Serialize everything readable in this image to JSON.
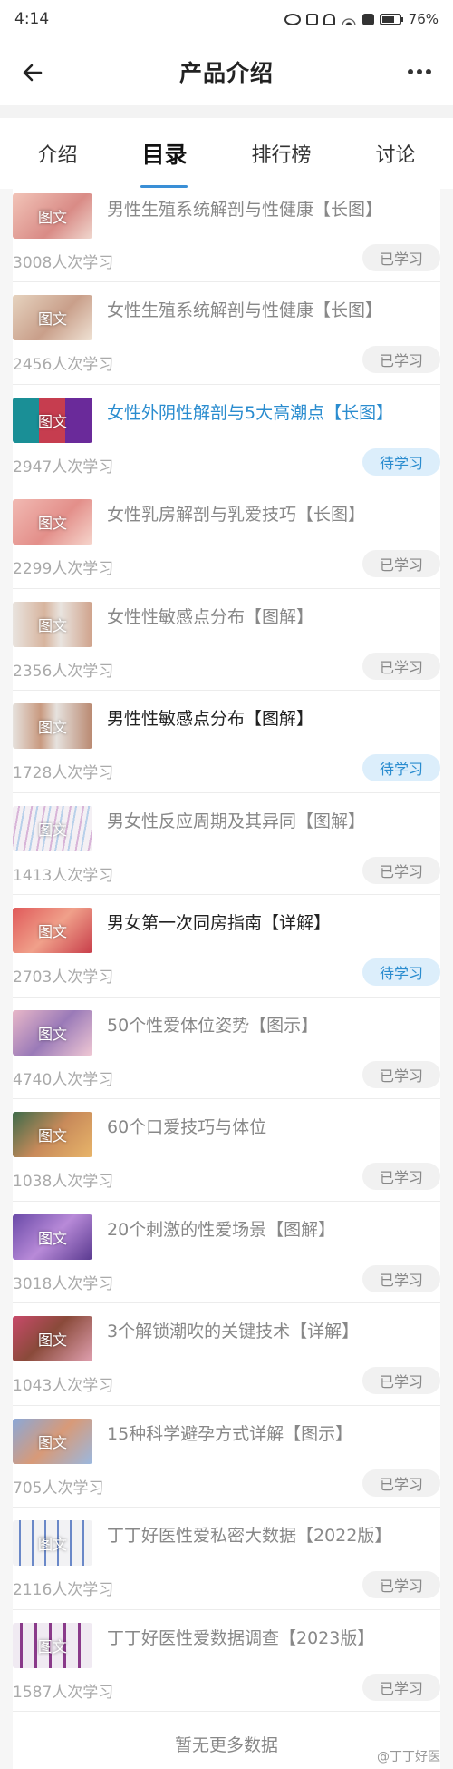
{
  "status_bar": {
    "time": "4:14",
    "battery": "76%",
    "icons": [
      "eye-icon",
      "nfc-icon",
      "mute-icon",
      "wifi-icon",
      "alert-icon",
      "battery-icon"
    ]
  },
  "header": {
    "title": "产品介绍",
    "back_icon": "arrow-left-icon",
    "more_icon": "more-dots-icon"
  },
  "tabs": [
    {
      "label": "介绍",
      "active": false
    },
    {
      "label": "目录",
      "active": true
    },
    {
      "label": "排行榜",
      "active": false
    },
    {
      "label": "讨论",
      "active": false
    }
  ],
  "colors": {
    "accent": "#2a8ccf",
    "todo_bg": "#dceefb"
  },
  "items": [
    {
      "thumb_label": "图文",
      "title": "男性生殖系统解剖与性健康【长图】",
      "count": "3008人次学习",
      "status": "已学习"
    },
    {
      "thumb_label": "图文",
      "title": "女性生殖系统解剖与性健康【长图】",
      "count": "2456人次学习",
      "status": "已学习"
    },
    {
      "thumb_label": "图文",
      "title": "女性外阴性解剖与5大高潮点【长图】",
      "count": "2947人次学习",
      "status": "待学习"
    },
    {
      "thumb_label": "图文",
      "title": "女性乳房解剖与乳爱技巧【长图】",
      "count": "2299人次学习",
      "status": "已学习"
    },
    {
      "thumb_label": "图文",
      "title": "女性性敏感点分布【图解】",
      "count": "2356人次学习",
      "status": "已学习"
    },
    {
      "thumb_label": "图文",
      "title": "男性性敏感点分布【图解】",
      "count": "1728人次学习",
      "status": "待学习"
    },
    {
      "thumb_label": "图文",
      "title": "男女性反应周期及其异同【图解】",
      "count": "1413人次学习",
      "status": "已学习"
    },
    {
      "thumb_label": "图文",
      "title": "男女第一次同房指南【详解】",
      "count": "2703人次学习",
      "status": "待学习"
    },
    {
      "thumb_label": "图文",
      "title": "50个性爱体位姿势【图示】",
      "count": "4740人次学习",
      "status": "已学习"
    },
    {
      "thumb_label": "图文",
      "title": "60个口爱技巧与体位",
      "count": "1038人次学习",
      "status": "已学习"
    },
    {
      "thumb_label": "图文",
      "title": "20个刺激的性爱场景【图解】",
      "count": "3018人次学习",
      "status": "已学习"
    },
    {
      "thumb_label": "图文",
      "title": "3个解锁潮吹的关键技术【详解】",
      "count": "1043人次学习",
      "status": "已学习"
    },
    {
      "thumb_label": "图文",
      "title": "15种科学避孕方式详解【图示】",
      "count": "705人次学习",
      "status": "已学习"
    },
    {
      "thumb_label": "图文",
      "title": "丁丁好医性爱私密大数据【2022版】",
      "count": "2116人次学习",
      "status": "已学习"
    },
    {
      "thumb_label": "图文",
      "title": "丁丁好医性爱数据调查【2023版】",
      "count": "1587人次学习",
      "status": "已学习"
    }
  ],
  "footer": {
    "text": "暂无更多数据"
  },
  "watermark": "@丁丁好医"
}
